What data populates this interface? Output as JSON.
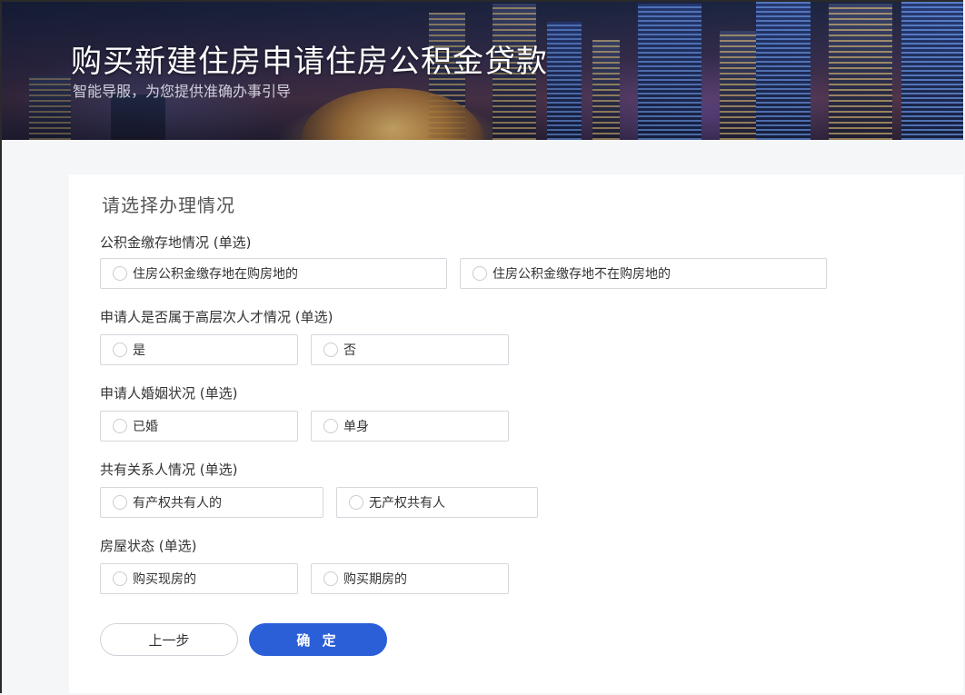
{
  "header": {
    "title": "购买新建住房申请住房公积金贷款",
    "subtitle": "智能导服，为您提供准确办事引导"
  },
  "form": {
    "section_title": "请选择办理情况",
    "questions": [
      {
        "label": "公积金缴存地情况 (单选)",
        "options": [
          "住房公积金缴存地在购房地的",
          "住房公积金缴存地不在购房地的"
        ]
      },
      {
        "label": "申请人是否属于高层次人才情况 (单选)",
        "options": [
          "是",
          "否"
        ]
      },
      {
        "label": "申请人婚姻状况 (单选)",
        "options": [
          "已婚",
          "单身"
        ]
      },
      {
        "label": "共有关系人情况 (单选)",
        "options": [
          "有产权共有人的",
          "无产权共有人"
        ]
      },
      {
        "label": "房屋状态 (单选)",
        "options": [
          "购买现房的",
          "购买期房的"
        ]
      }
    ]
  },
  "actions": {
    "prev_label": "上一步",
    "confirm_label": "确 定"
  },
  "colors": {
    "primary": "#2a5fd8",
    "border": "#d4d7dc",
    "page_bg": "#f5f6f8"
  },
  "icons": {
    "radio": "radio-unchecked-icon"
  }
}
